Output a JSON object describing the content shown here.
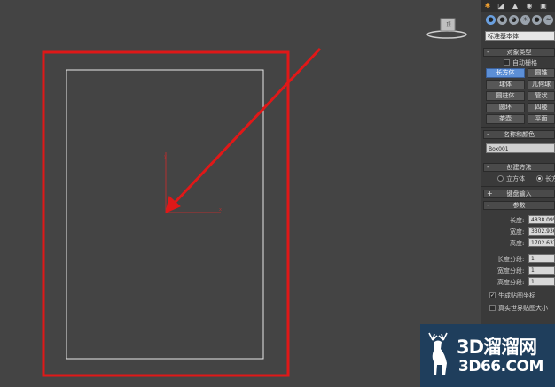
{
  "panel": {
    "tabs": [
      "✱",
      "◪",
      "▲",
      "◉",
      "▣"
    ],
    "category_icons": [
      "●",
      "●",
      "◕",
      "☀",
      "●",
      "≈",
      "✱"
    ],
    "dropdown_value": "标准基本体",
    "object_type": {
      "header": "对象类型",
      "autogrid_label": "自动栅格",
      "buttons": [
        "长方体",
        "圆锥",
        "球体",
        "几何球",
        "圆柱体",
        "管状",
        "圆环",
        "四棱",
        "茶壶",
        "平面"
      ]
    },
    "name_color": {
      "header": "名称和颜色",
      "name_value": "Box001"
    },
    "creation_method": {
      "header": "创建方法",
      "options": [
        "立方体",
        "长方"
      ]
    },
    "keyboard_entry": {
      "header": "键盘输入"
    },
    "parameters": {
      "header": "参数",
      "length_label": "长度:",
      "length_value": "4838.095",
      "width_label": "宽度:",
      "width_value": "3302.936",
      "height_label": "高度:",
      "height_value": "1702.637",
      "length_segs_label": "长度分段:",
      "length_segs_value": "1",
      "width_segs_label": "宽度分段:",
      "width_segs_value": "1",
      "height_segs_label": "高度分段:",
      "height_segs_value": "1",
      "gen_mapping_label": "生成贴图坐标",
      "real_world_label": "真实世界贴图大小"
    }
  },
  "viewcube_label": "顶",
  "watermark": {
    "top": "3D溜溜网",
    "bottom": "3D66.COM"
  },
  "colors": {
    "highlight_red": "#e01818",
    "active_button": "#5c8fd6",
    "watermark_bg": "#1f3e5c"
  }
}
